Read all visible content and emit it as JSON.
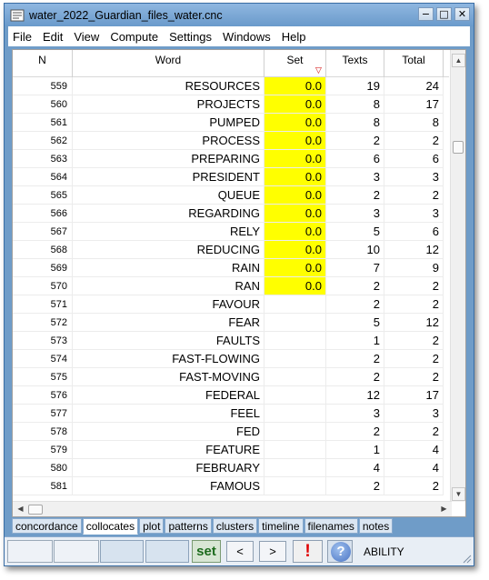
{
  "window": {
    "title": "water_2022_Guardian_files_water.cnc",
    "controls": {
      "minimize": "−",
      "maximize": "□",
      "close": "✕"
    }
  },
  "menu": [
    "File",
    "Edit",
    "View",
    "Compute",
    "Settings",
    "Windows",
    "Help"
  ],
  "columns": {
    "n": "N",
    "word": "Word",
    "set": "Set",
    "texts": "Texts",
    "total": "Total"
  },
  "sort_marker": "▽",
  "rows": [
    {
      "n": "559",
      "word": "RESOURCES",
      "set": "0.0",
      "texts": "19",
      "total": "24"
    },
    {
      "n": "560",
      "word": "PROJECTS",
      "set": "0.0",
      "texts": "8",
      "total": "17"
    },
    {
      "n": "561",
      "word": "PUMPED",
      "set": "0.0",
      "texts": "8",
      "total": "8"
    },
    {
      "n": "562",
      "word": "PROCESS",
      "set": "0.0",
      "texts": "2",
      "total": "2"
    },
    {
      "n": "563",
      "word": "PREPARING",
      "set": "0.0",
      "texts": "6",
      "total": "6"
    },
    {
      "n": "564",
      "word": "PRESIDENT",
      "set": "0.0",
      "texts": "3",
      "total": "3"
    },
    {
      "n": "565",
      "word": "QUEUE",
      "set": "0.0",
      "texts": "2",
      "total": "2"
    },
    {
      "n": "566",
      "word": "REGARDING",
      "set": "0.0",
      "texts": "3",
      "total": "3"
    },
    {
      "n": "567",
      "word": "RELY",
      "set": "0.0",
      "texts": "5",
      "total": "6"
    },
    {
      "n": "568",
      "word": "REDUCING",
      "set": "0.0",
      "texts": "10",
      "total": "12"
    },
    {
      "n": "569",
      "word": "RAIN",
      "set": "0.0",
      "texts": "7",
      "total": "9"
    },
    {
      "n": "570",
      "word": "RAN",
      "set": "0.0",
      "texts": "2",
      "total": "2"
    },
    {
      "n": "571",
      "word": "FAVOUR",
      "set": "",
      "texts": "2",
      "total": "2"
    },
    {
      "n": "572",
      "word": "FEAR",
      "set": "",
      "texts": "5",
      "total": "12"
    },
    {
      "n": "573",
      "word": "FAULTS",
      "set": "",
      "texts": "1",
      "total": "2"
    },
    {
      "n": "574",
      "word": "FAST-FLOWING",
      "set": "",
      "texts": "2",
      "total": "2"
    },
    {
      "n": "575",
      "word": "FAST-MOVING",
      "set": "",
      "texts": "2",
      "total": "2"
    },
    {
      "n": "576",
      "word": "FEDERAL",
      "set": "",
      "texts": "12",
      "total": "17"
    },
    {
      "n": "577",
      "word": "FEEL",
      "set": "",
      "texts": "3",
      "total": "3"
    },
    {
      "n": "578",
      "word": "FED",
      "set": "",
      "texts": "2",
      "total": "2"
    },
    {
      "n": "579",
      "word": "FEATURE",
      "set": "",
      "texts": "1",
      "total": "4"
    },
    {
      "n": "580",
      "word": "FEBRUARY",
      "set": "",
      "texts": "4",
      "total": "4"
    },
    {
      "n": "581",
      "word": "FAMOUS",
      "set": "",
      "texts": "2",
      "total": "2"
    }
  ],
  "tabs": [
    "concordance",
    "collocates",
    "plot",
    "patterns",
    "clusters",
    "timeline",
    "filenames",
    "notes"
  ],
  "active_tab": "collocates",
  "status": {
    "set_label": "set",
    "prev_label": "<",
    "next_label": ">",
    "alert_label": "!",
    "help_label": "?",
    "status_text": "ABILITY"
  },
  "colors": {
    "highlight": "#ffff00",
    "window_frame": "#6f9cc8",
    "sort_marker": "#d00000",
    "set_button_text": "#1d6b1d",
    "alert": "#e00000"
  }
}
